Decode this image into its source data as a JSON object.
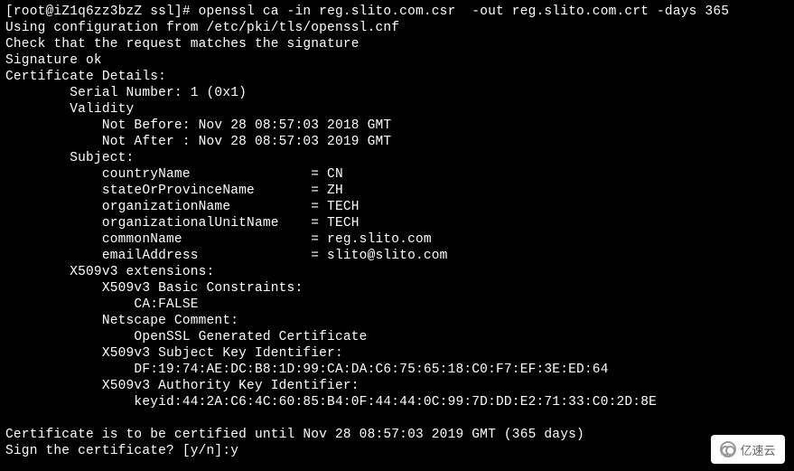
{
  "terminal": {
    "prompt": "[root@iZ1q6zz3bzZ ssl]# ",
    "command": "openssl ca -in reg.slito.com.csr  -out reg.slito.com.crt -days 365",
    "lines": {
      "l1": "Using configuration from /etc/pki/tls/openssl.cnf",
      "l2": "Check that the request matches the signature",
      "l3": "Signature ok",
      "l4": "Certificate Details:",
      "l5": "        Serial Number: 1 (0x1)",
      "l6": "        Validity",
      "l7": "            Not Before: Nov 28 08:57:03 2018 GMT",
      "l8": "            Not After : Nov 28 08:57:03 2019 GMT",
      "l9": "        Subject:",
      "l10": "            countryName               = CN",
      "l11": "            stateOrProvinceName       = ZH",
      "l12": "            organizationName          = TECH",
      "l13": "            organizationalUnitName    = TECH",
      "l14": "            commonName                = reg.slito.com",
      "l15": "            emailAddress              = slito@slito.com",
      "l16": "        X509v3 extensions:",
      "l17": "            X509v3 Basic Constraints: ",
      "l18": "                CA:FALSE",
      "l19": "            Netscape Comment: ",
      "l20": "                OpenSSL Generated Certificate",
      "l21": "            X509v3 Subject Key Identifier: ",
      "l22": "                DF:19:74:AE:DC:B8:1D:99:CA:DA:C6:75:65:18:C0:F7:EF:3E:ED:64",
      "l23": "            X509v3 Authority Key Identifier: ",
      "l24": "                keyid:44:2A:C6:4C:60:85:B4:0F:44:44:0C:99:7D:DD:E2:71:33:C0:2D:8E",
      "l25": "",
      "l26": "Certificate is to be certified until Nov 28 08:57:03 2019 GMT (365 days)",
      "l27": "Sign the certificate? [y/n]:y"
    }
  },
  "watermark": {
    "text": "亿速云"
  }
}
